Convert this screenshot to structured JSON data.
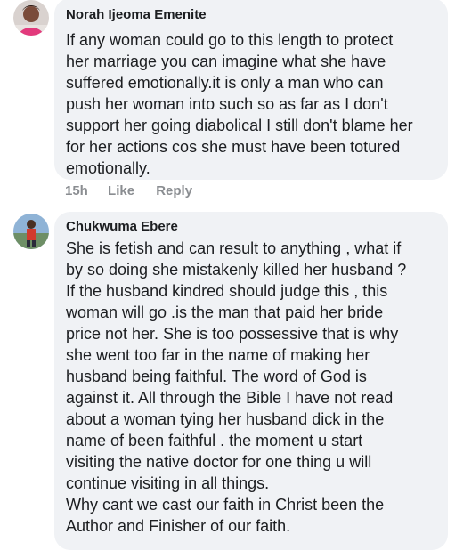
{
  "comments": [
    {
      "author": "Norah Ijeoma Emenite",
      "text": "If  any woman could go to this length to protect\nher marriage you can imagine what she have\nsuffered emotionally.it is only a man who can\npush her woman into such so as far as I don't\nsupport her going diabolical I still don't blame her\nfor her actions cos she must have been totured\nemotionally.",
      "time": "15h",
      "like_label": "Like",
      "reply_label": "Reply"
    },
    {
      "author": "Chukwuma Ebere",
      "text": "She is fetish and can result to anything , what if\nby so doing she mistakenly killed her husband ?\nIf the husband kindred should judge this , this\nwoman will go .is the man that paid her bride\nprice not her. She is too possessive that is why\nshe went too far in the name of making her\nhusband being faithful. The word of God is\nagainst it. All through the Bible I have not read\nabout a woman tying her husband dick in the\nname of been faithful . the moment u start\nvisiting the native doctor for one thing u will\ncontinue visiting in all things.\nWhy cant we cast our faith in Christ been the\nAuthor and Finisher of our faith."
    }
  ]
}
